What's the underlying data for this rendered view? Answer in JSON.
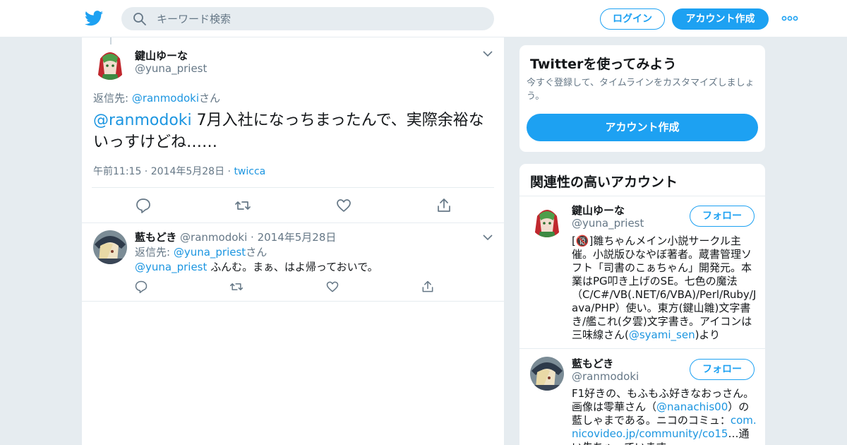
{
  "header": {
    "search_placeholder": "キーワード検索",
    "login_label": "ログイン",
    "signup_label": "アカウント作成",
    "brand_color": "#1da1f2",
    "icons": [
      "twitter-bird-icon",
      "search-icon",
      "more-icon"
    ]
  },
  "tweet_main": {
    "name": "鍵山ゆーな",
    "handle": "@yuna_priest",
    "reply_to_prefix": "返信先: ",
    "reply_to_handle": "@ranmodoki",
    "reply_to_suffix": "さん",
    "mention": "@ranmodoki",
    "text": " 7月入社になっちまったんで、実際余裕ないっすけどね……",
    "time": "午前11:15",
    "date": "2014年5月28日",
    "source": "twicca"
  },
  "tweet_reply": {
    "name": "藍もどき",
    "handle": "@ranmodoki",
    "date": "2014年5月28日",
    "reply_to_prefix": "返信先: ",
    "reply_to_handle": "@yuna_priest",
    "reply_to_suffix": "さん",
    "mention": "@yuna_priest",
    "text": " ふんむ。まぁ、はよ帰っておいで。"
  },
  "sidebar": {
    "signup_card": {
      "title": "Twitterを使ってみよう",
      "description": "今すぐ登録して、タイムラインをカスタマイズしましょう。",
      "button": "アカウント作成"
    },
    "related": {
      "title": "関連性の高いアカウント",
      "accounts": [
        {
          "name": "鍵山ゆーな",
          "handle": "@yuna_priest",
          "follow": "フォロー",
          "bio_before": "[🔞]雛ちゃんメイン小説サークル主催。小説版ひなやぼ著者。蔵書管理ソフト「司書のこぁちゃん」開発元。本業はPG叩き上げのSE。七色の魔法（C/C#/VB(.NET/6/VBA)/Perl/Ruby/Java/PHP）使い。東方(鍵山雛)文字書き/艦これ(夕雲)文字書き。アイコンは三味線さん(",
          "bio_link": "@syami_sen",
          "bio_after": ")より"
        },
        {
          "name": "藍もどき",
          "handle": "@ranmodoki",
          "follow": "フォロー",
          "bio_before": "F1好きの、もふもふ好きなおっさん。画像は零華さん（",
          "bio_link": "@nanachis00",
          "bio_mid": "）の藍しゃまである。ニコのコミュ：",
          "bio_link2": "com.nicovideo.jp/community/co15",
          "bio_after": "…通い先ちゃっています"
        }
      ]
    }
  }
}
